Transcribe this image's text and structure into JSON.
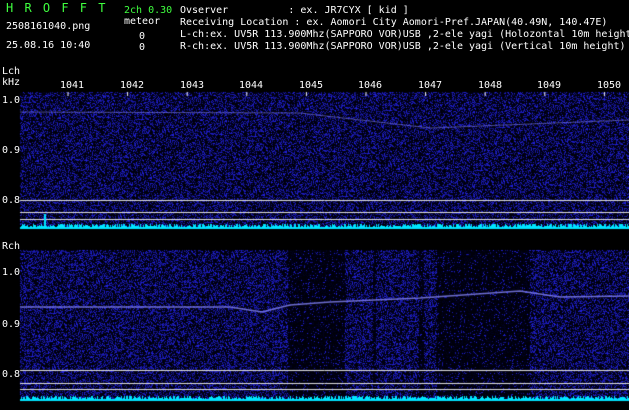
{
  "header": {
    "app_name": "H R O F F T",
    "channel_info": "2ch 0.30",
    "file_name": "2508161040.png",
    "meteor_label": "meteor",
    "datetime": "25.08.16 10:40",
    "meteor_count_l": "0",
    "meteor_count_r": "0",
    "observer_line": "Ovserver          : ex. JR7CYX [ kid ]",
    "location_line": "Receiving Location : ex. Aomori City Aomori-Pref.JAPAN(40.49N, 140.47E)",
    "lch_line": "L-ch:ex. UV5R 113.900Mhz(SAPPORO VOR)USB ,2-ele yagi (Holozontal 10m height)",
    "rch_line": "R-ch:ex. UV5R 113.900Mhz(SAPPORO VOR)USB ,2-ele yagi (Vertical 10m height)"
  },
  "lch_panel": {
    "title": "Lch",
    "unit": "kHz",
    "freq_ticks": [
      "1041",
      "1042",
      "1043",
      "1044",
      "1045",
      "1046",
      "1047",
      "1048",
      "1049",
      "1050"
    ],
    "y_ticks": [
      "1.0",
      "0.9",
      "0.8"
    ]
  },
  "rch_panel": {
    "title": "Rch",
    "y_ticks": [
      "1.0",
      "0.9",
      "0.8"
    ]
  },
  "colors": {
    "background": "#000000",
    "header_green": "#3fff3f",
    "noise_blue": "#1a1ac8",
    "signal_line": "#8a8aff",
    "level_cyan": "#00e5ff",
    "ref_line": "#e0e0e0"
  }
}
